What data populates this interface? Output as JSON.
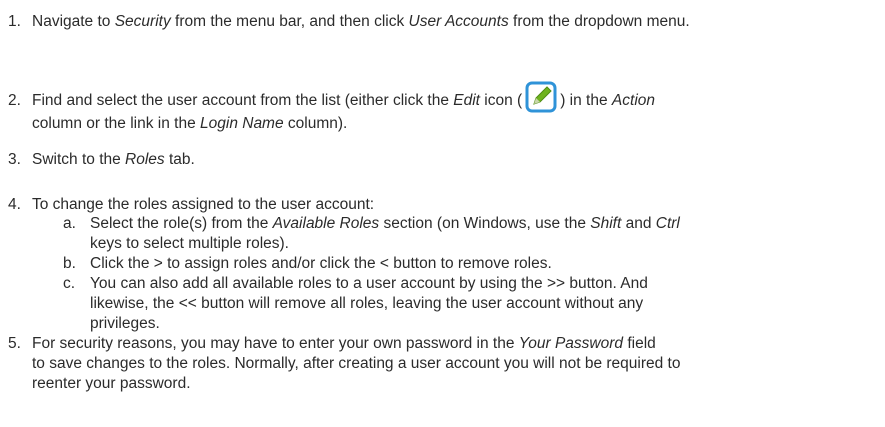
{
  "steps": [
    {
      "num": "1.",
      "t1": "Navigate to ",
      "i1": "Security",
      "t2": " from the menu bar, and then click ",
      "i2": "User Accounts",
      "t3": " from the dropdown menu."
    },
    {
      "num": "2.",
      "t1": "Find and select the user account from the list (either click the ",
      "i1": "Edit",
      "t2": " icon (",
      "t3": ") in the ",
      "i2": "Action",
      "line2_t1": "column or the link in the ",
      "line2_i1": "Login Name",
      "line2_t2": " column)."
    },
    {
      "num": "3.",
      "t1": "Switch to the ",
      "i1": "Roles",
      "t2": " tab."
    },
    {
      "num": "4.",
      "t1": "To change the roles assigned to the user account:"
    },
    {
      "num": "5.",
      "line1": "For security reasons, you may have to enter your own password in the ",
      "i1": "Your Password",
      "line1_end": " field",
      "line2": "to save changes to the roles. Normally, after creating a user account you will not be required to",
      "line3": "reenter your password."
    }
  ],
  "substeps": [
    {
      "letter": "a.",
      "t1": "Select the role(s) from the ",
      "i1": "Available Roles",
      "t2": " section (on Windows, use the ",
      "i2": "Shift",
      "t3": " and ",
      "i3": "Ctrl",
      "line2": "keys to select multiple roles)."
    },
    {
      "letter": "b.",
      "text": "Click the > to assign roles and/or click the < button to remove roles."
    },
    {
      "letter": "c.",
      "line1": "You can also add all available roles to a user account by using the >> button. And",
      "line2": "likewise, the << button will remove all roles, leaving the user account without any",
      "line3": "privileges."
    }
  ],
  "icon": {
    "name": "edit-icon",
    "frame_color": "#2f93d8",
    "pencil_color": "#6fb31e"
  }
}
